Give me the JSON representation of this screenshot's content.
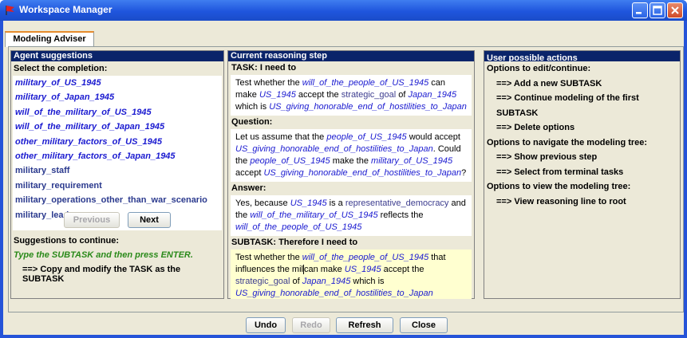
{
  "window": {
    "title": "Workspace Manager"
  },
  "tab": {
    "label": "Modeling Adviser"
  },
  "left": {
    "header": "Agent suggestions",
    "select_label": "Select the completion:",
    "suggestions": [
      "military_of_US_1945",
      "military_of_Japan_1945",
      "will_of_the_military_of_US_1945",
      "will_of_the_military_of_Japan_1945",
      "other_military_factors_of_US_1945",
      "other_military_factors_of_Japan_1945",
      "military_staff",
      "military_requirement",
      "military_operations_other_than_war_scenario",
      "military_leader"
    ],
    "previous_label": "Previous",
    "next_label": "Next",
    "continue_label": "Suggestions to continue:",
    "hint": "Type the SUBTASK and then press ENTER.",
    "copy_option": "==> Copy and modify the TASK as the SUBTASK"
  },
  "middle": {
    "header": "Current reasoning step",
    "task_head": "TASK: I need to",
    "task": {
      "t1": "Test whether the ",
      "l1": "will_of_the_people_of_US_1945",
      "t2": " can make ",
      "l2": "US_1945",
      "t3": " accept the ",
      "g1": "strategic_goal",
      "t4": " of ",
      "l3": "Japan_1945",
      "t5": " which is ",
      "l4": "US_giving_honorable_end_of_hostilities_to_Japan"
    },
    "question_head": "Question:",
    "question": {
      "t1": "Let us assume that the ",
      "l1": "people_of_US_1945",
      "t2": " would accept ",
      "l2": "US_giving_honorable_end_of_hostilities_to_Japan",
      "t3": ". Could the ",
      "l3": "people_of_US_1945",
      "t4": " make the ",
      "l4": "military_of_US_1945",
      "t5": " accept ",
      "l5": "US_giving_honorable_end_of_hostilities_to_Japan",
      "t6": "?"
    },
    "answer_head": "Answer:",
    "answer": {
      "t1": "Yes, because ",
      "l1": "US_1945",
      "t2": " is a ",
      "g1": "representative_democracy",
      "t3": " and the ",
      "l2": "will_of_the_military_of_US_1945",
      "t4": " reflects the ",
      "l3": "will_of_the_people_of_US_1945"
    },
    "subtask_head": "SUBTASK: Therefore I need to",
    "subtask": {
      "t1": "Test whether the ",
      "l1": "will_of_the_people_of_US_1945",
      "t2": " that influences the mil",
      "t3": "can make ",
      "l2": "US_1945",
      "t4": " accept the ",
      "g1": "strategic_goal",
      "t5": " of ",
      "l3": "Japan_1945",
      "t6": " which is ",
      "l4": "US_giving_honorable_end_of_hostilities_to_Japan"
    }
  },
  "right": {
    "header": "User possible actions",
    "edit_label": "Options to edit/continue:",
    "edit_items": [
      "==> Add a new SUBTASK",
      "==> Continue modeling of the first SUBTASK",
      "==> Delete options"
    ],
    "nav_label": "Options to navigate the modeling tree:",
    "nav_items": [
      "==> Show previous step",
      "==> Select from terminal tasks"
    ],
    "view_label": "Options to view the modeling tree:",
    "view_items": [
      "==> View reasoning line to root"
    ]
  },
  "bottom": {
    "undo": "Undo",
    "redo": "Redo",
    "refresh": "Refresh",
    "close": "Close"
  },
  "colors": {
    "titlebar": "#2553d8",
    "header": "#0a246a",
    "link": "#1a1ad0",
    "hint": "#2a8a1a",
    "subtask_bg": "#ffffd0"
  }
}
